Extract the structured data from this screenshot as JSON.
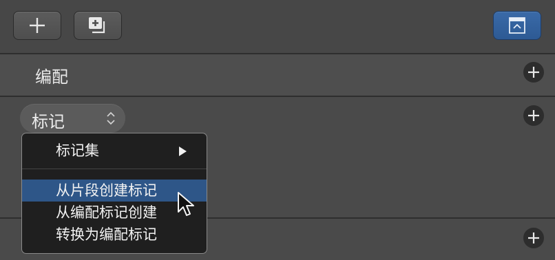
{
  "toolbar": {
    "add_icon": "plus-icon",
    "duplicate_icon": "add-copy-icon",
    "collapse_icon": "collapse-panel-icon"
  },
  "sections": {
    "match": {
      "label": "编配",
      "add_icon": "plus-circle-icon"
    },
    "markers": {
      "popup_value": "标记",
      "popup_icon": "up-down-chevron-icon",
      "add_icon": "plus-circle-icon"
    },
    "bottom": {
      "add_icon": "plus-circle-icon"
    }
  },
  "menu": {
    "items": [
      {
        "label": "标记集",
        "submenu": true
      },
      {
        "label": "从片段创建标记",
        "highlighted": true
      },
      {
        "label": "从编配标记创建"
      },
      {
        "label": "转换为编配标记"
      }
    ]
  },
  "colors": {
    "background": "#4a4a4a",
    "highlight": "#2e5688",
    "accent_button": "#3a6aa8"
  }
}
